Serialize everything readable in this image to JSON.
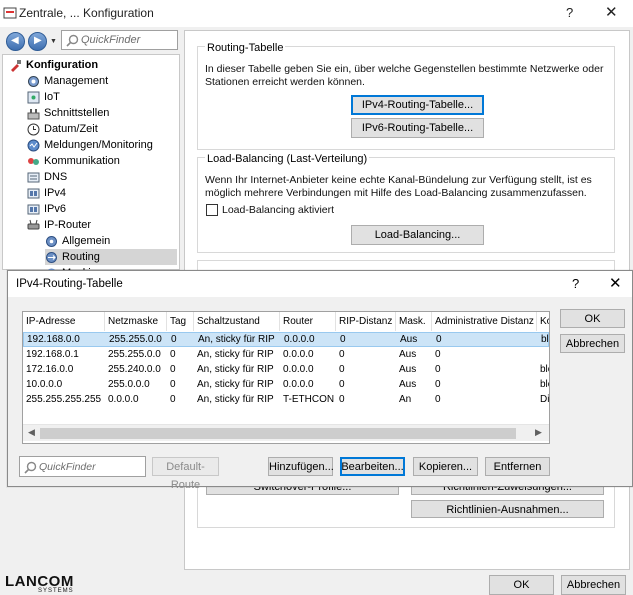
{
  "window": {
    "title": "Zentrale, ... Konfiguration",
    "help": "?",
    "close": "✕",
    "quickfinder_placeholder": "QuickFinder",
    "back": "◀",
    "forward": "▶",
    "dropdown": "▼"
  },
  "tree": [
    {
      "label": "Konfiguration",
      "icon": "config-icon"
    },
    {
      "label": "Management",
      "icon": "management-icon"
    },
    {
      "label": "IoT",
      "icon": "iot-icon"
    },
    {
      "label": "Schnittstellen",
      "icon": "interfaces-icon"
    },
    {
      "label": "Datum/Zeit",
      "icon": "clock-icon"
    },
    {
      "label": "Meldungen/Monitoring",
      "icon": "monitoring-icon"
    },
    {
      "label": "Kommunikation",
      "icon": "communication-icon"
    },
    {
      "label": "DNS",
      "icon": "dns-icon"
    },
    {
      "label": "IPv4",
      "icon": "ipv4-icon"
    },
    {
      "label": "IPv6",
      "icon": "ipv6-icon"
    },
    {
      "label": "IP-Router",
      "icon": "router-icon"
    },
    {
      "label": "Allgemein",
      "icon": "general-icon"
    },
    {
      "label": "Routing",
      "icon": "routing-icon"
    },
    {
      "label": "Maskierung",
      "icon": "masking-icon"
    }
  ],
  "routing_table": {
    "title": "Routing-Tabelle",
    "description": "In dieser Tabelle geben Sie ein, über welche Gegenstellen bestimmte Netzwerke oder Stationen erreicht werden können.",
    "ipv4_button": "IPv4-Routing-Tabelle...",
    "ipv6_button": "IPv6-Routing-Tabelle..."
  },
  "load_balancing": {
    "title": "Load-Balancing (Last-Verteilung)",
    "description": "Wenn Ihr Internet-Anbieter keine echte Kanal-Bündelung zur Verfügung stellt, ist es möglich mehrere Verbindungen mit Hilfe des Load-Balancing zusammenzufassen.",
    "checkbox_label": "Load-Balancing aktiviert",
    "checkbox_checked": false,
    "button": "Load-Balancing..."
  },
  "lower_buttons": {
    "switchover": "Switchover-Profile...",
    "richtlinien_zuweisungen": "Richtlinien-Zuweisungen...",
    "richtlinien_ausnahmen": "Richtlinien-Ausnahmen..."
  },
  "footer": {
    "logo": "LANCOM",
    "logo_sub": "SYSTEMS",
    "ok": "OK",
    "cancel": "Abbrechen"
  },
  "dialog": {
    "title": "IPv4-Routing-Tabelle",
    "help": "?",
    "close": "✕",
    "ok": "OK",
    "cancel": "Abbrechen",
    "quickfinder_placeholder": "QuickFinder",
    "default_route": "Default-Route",
    "add": "Hinzufügen...",
    "edit": "Bearbeiten...",
    "copy": "Kopieren...",
    "remove": "Entfernen",
    "columns": [
      "IP-Adresse",
      "Netzmaske",
      "Tag",
      "Schaltzustand",
      "Router",
      "RIP-Distanz",
      "Mask.",
      "Administrative Distanz",
      "Ko"
    ],
    "rows": [
      [
        "192.168.0.0",
        "255.255.0.0",
        "0",
        "An, sticky für RIP",
        "0.0.0.0",
        "0",
        "Aus",
        "0",
        "blo"
      ],
      [
        "192.168.0.1",
        "255.255.0.0",
        "0",
        "An, sticky für RIP",
        "0.0.0.0",
        "0",
        "Aus",
        "0",
        ""
      ],
      [
        "172.16.0.0",
        "255.240.0.0",
        "0",
        "An, sticky für RIP",
        "0.0.0.0",
        "0",
        "Aus",
        "0",
        "blo"
      ],
      [
        "10.0.0.0",
        "255.0.0.0",
        "0",
        "An, sticky für RIP",
        "0.0.0.0",
        "0",
        "Aus",
        "0",
        "blo"
      ],
      [
        "255.255.255.255",
        "0.0.0.0",
        "0",
        "An, sticky für RIP",
        "T-ETHCON",
        "0",
        "An",
        "0",
        "Die"
      ]
    ],
    "selected_row": 0,
    "scroll_left": "◀",
    "scroll_right": "▶"
  }
}
